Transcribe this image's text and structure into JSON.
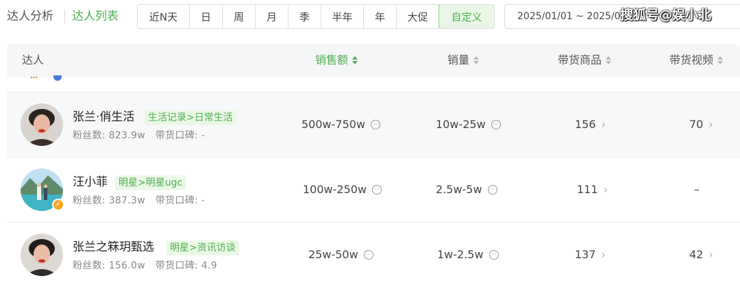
{
  "breadcrumb": {
    "analysis": "达人分析",
    "list": "达人列表"
  },
  "date_ranges": [
    {
      "label": "近N天",
      "active": false
    },
    {
      "label": "日",
      "active": false
    },
    {
      "label": "周",
      "active": false
    },
    {
      "label": "月",
      "active": false
    },
    {
      "label": "季",
      "active": false
    },
    {
      "label": "半年",
      "active": false
    },
    {
      "label": "年",
      "active": false
    },
    {
      "label": "大促",
      "active": false
    },
    {
      "label": "自定义",
      "active": true
    }
  ],
  "date_input": {
    "value": "2025/01/01 ~ 2025/0…"
  },
  "watermark": "搜狐号@娱小北",
  "table": {
    "columns": {
      "influencer": "达人",
      "sales_amount": "销售额",
      "sales_volume": "销量",
      "products": "带货商品",
      "videos": "带货视频"
    },
    "partial_row_logo": "…",
    "rows": [
      {
        "name": "张兰·俏生活",
        "tag": "生活记录>日常生活",
        "followers_label": "粉丝数:",
        "followers": "823.9w",
        "rating_label": "带货口碑:",
        "rating": "-",
        "sales_amount": "500w-750w",
        "sales_volume": "10w-25w",
        "products": "156",
        "videos": "70"
      },
      {
        "name": "汪小菲",
        "tag": "明星>明星ugc",
        "followers_label": "粉丝数:",
        "followers": "387.3w",
        "rating_label": "带货口碑:",
        "rating": "-",
        "sales_amount": "100w-250w",
        "sales_volume": "2.5w-5w",
        "products": "111",
        "videos": "–"
      },
      {
        "name": "张兰之箖玥甄选",
        "tag": "明星>资讯访谈",
        "followers_label": "粉丝数:",
        "followers": "156.0w",
        "rating_label": "带货口碑:",
        "rating": "4.9",
        "sales_amount": "25w-50w",
        "sales_volume": "1w-2.5w",
        "products": "137",
        "videos": "42"
      }
    ]
  },
  "colors": {
    "accent": "#4caf50",
    "tag_bg": "#ecf8e7",
    "header_bg": "#f5f6f7"
  }
}
